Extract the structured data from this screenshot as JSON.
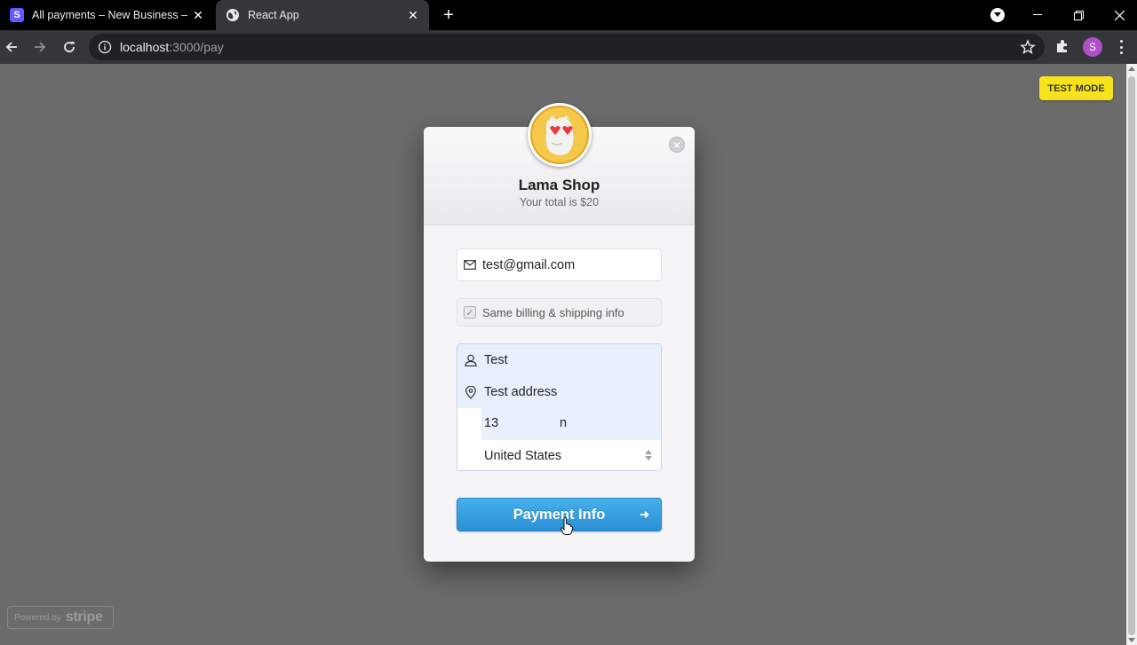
{
  "browser": {
    "tabs": [
      {
        "title": "All payments – New Business – St",
        "favicon": "stripe-s"
      },
      {
        "title": "React App",
        "favicon": "globe-icon"
      }
    ],
    "new_tab_label": "+",
    "url": {
      "host": "localhost",
      "path": ":3000/pay"
    }
  },
  "page": {
    "test_mode_label": "TEST MODE",
    "powered_by": {
      "prefix": "Powered by",
      "brand": "stripe"
    }
  },
  "checkout": {
    "shop_name": "Lama Shop",
    "total_text": "Your total is $20",
    "email": "test@gmail.com",
    "same_billing_label": "Same billing & shipping info",
    "same_billing_checked": true,
    "name": "Test",
    "address": "Test address",
    "zip": "13",
    "city": "n",
    "country": "United States",
    "pay_button_label": "Payment Info"
  },
  "colors": {
    "overlay": "#6b6b6b",
    "button": "#2c8fd6",
    "test_mode_bg": "#f8e21c",
    "autofill": "#e8f0fe"
  }
}
